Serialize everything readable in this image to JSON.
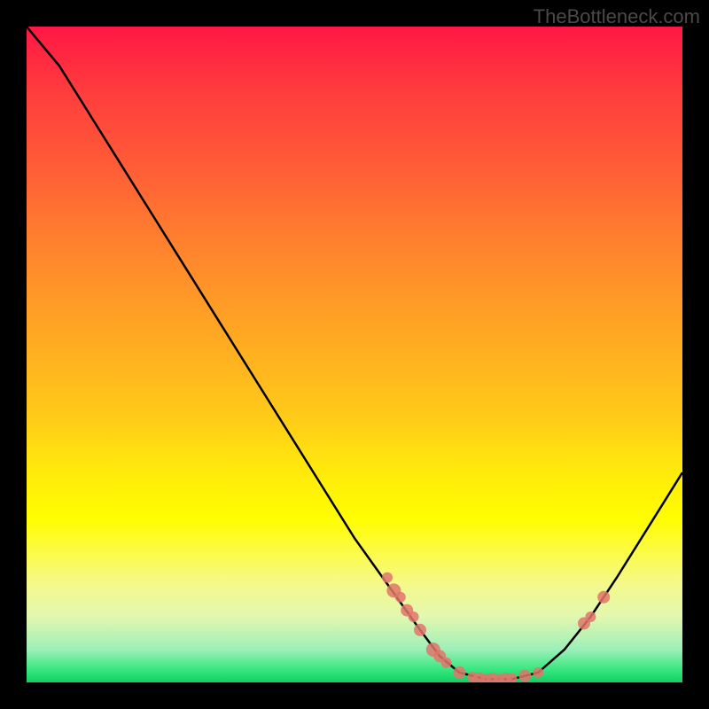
{
  "watermark": "TheBottleneck.com",
  "chart_data": {
    "type": "line",
    "title": "",
    "xlabel": "",
    "ylabel": "",
    "xlim": [
      0,
      100
    ],
    "ylim": [
      0,
      100
    ],
    "curve_points": [
      {
        "x": 0,
        "y": 100
      },
      {
        "x": 5,
        "y": 94
      },
      {
        "x": 10,
        "y": 86
      },
      {
        "x": 15,
        "y": 78
      },
      {
        "x": 20,
        "y": 70
      },
      {
        "x": 25,
        "y": 62
      },
      {
        "x": 30,
        "y": 54
      },
      {
        "x": 35,
        "y": 46
      },
      {
        "x": 40,
        "y": 38
      },
      {
        "x": 45,
        "y": 30
      },
      {
        "x": 50,
        "y": 22
      },
      {
        "x": 55,
        "y": 15
      },
      {
        "x": 60,
        "y": 8
      },
      {
        "x": 63,
        "y": 4
      },
      {
        "x": 66,
        "y": 1.5
      },
      {
        "x": 70,
        "y": 0.5
      },
      {
        "x": 74,
        "y": 0.5
      },
      {
        "x": 78,
        "y": 1.5
      },
      {
        "x": 82,
        "y": 5
      },
      {
        "x": 86,
        "y": 10
      },
      {
        "x": 90,
        "y": 16
      },
      {
        "x": 95,
        "y": 24
      },
      {
        "x": 100,
        "y": 32
      }
    ],
    "markers": [
      {
        "x": 55,
        "y": 16,
        "size": 6
      },
      {
        "x": 56,
        "y": 14,
        "size": 8
      },
      {
        "x": 57,
        "y": 13,
        "size": 6
      },
      {
        "x": 58,
        "y": 11,
        "size": 7
      },
      {
        "x": 59,
        "y": 10,
        "size": 6
      },
      {
        "x": 60,
        "y": 8,
        "size": 7
      },
      {
        "x": 62,
        "y": 5,
        "size": 8
      },
      {
        "x": 63,
        "y": 4,
        "size": 7
      },
      {
        "x": 64,
        "y": 3,
        "size": 6
      },
      {
        "x": 66,
        "y": 1.5,
        "size": 7
      },
      {
        "x": 68,
        "y": 0.8,
        "size": 6
      },
      {
        "x": 69,
        "y": 0.6,
        "size": 7
      },
      {
        "x": 70,
        "y": 0.5,
        "size": 6
      },
      {
        "x": 71,
        "y": 0.5,
        "size": 7
      },
      {
        "x": 72,
        "y": 0.5,
        "size": 6
      },
      {
        "x": 73,
        "y": 0.5,
        "size": 7
      },
      {
        "x": 74,
        "y": 0.6,
        "size": 6
      },
      {
        "x": 76,
        "y": 1,
        "size": 7
      },
      {
        "x": 78,
        "y": 1.5,
        "size": 6
      },
      {
        "x": 85,
        "y": 9,
        "size": 7
      },
      {
        "x": 86,
        "y": 10,
        "size": 6
      },
      {
        "x": 88,
        "y": 13,
        "size": 7
      }
    ],
    "gradient_colors": {
      "top": "#ff1744",
      "middle": "#ffeb3b",
      "bottom": "#38e780"
    }
  }
}
